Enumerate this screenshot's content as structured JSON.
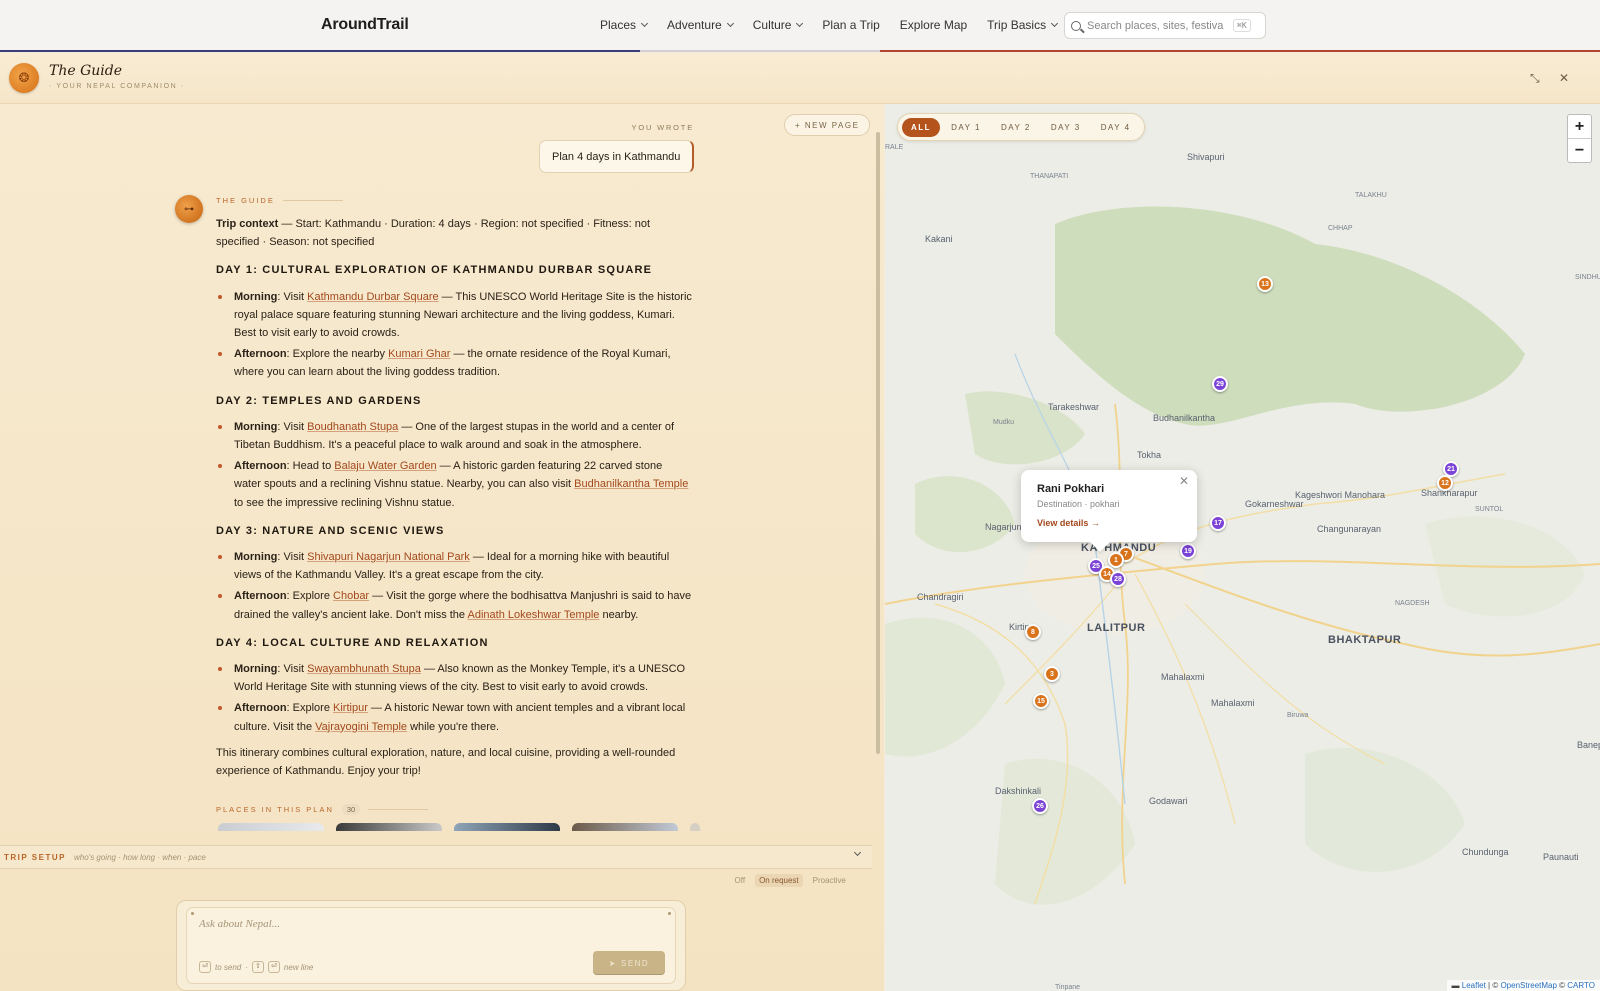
{
  "topnav": {
    "brand": "AroundTrail",
    "menu": [
      {
        "label": "Places",
        "dropdown": true
      },
      {
        "label": "Adventure",
        "dropdown": true
      },
      {
        "label": "Culture",
        "dropdown": true
      },
      {
        "label": "Plan a Trip",
        "dropdown": false
      },
      {
        "label": "Explore Map",
        "dropdown": false
      },
      {
        "label": "Trip Basics",
        "dropdown": true
      }
    ],
    "search_placeholder": "Search places, sites, festiva",
    "search_shortcut": "⌘K"
  },
  "guide": {
    "title": "The Guide",
    "subtitle": "· YOUR NEPAL COMPANION ·"
  },
  "chat": {
    "new_page": "+ NEW PAGE",
    "you_wrote": "YOU WROTE",
    "user_message": "Plan 4 days in Kathmandu",
    "guide_tag": "THE GUIDE",
    "context_label": "Trip context",
    "context_text": " — Start: Kathmandu · Duration: 4 days · Region: not specified · Fitness: not specified · Season: not specified",
    "days": [
      {
        "heading": "DAY 1: CULTURAL EXPLORATION OF KATHMANDU DURBAR SQUARE",
        "items": [
          {
            "time": "Morning",
            "pre": ": Visit ",
            "link": "Kathmandu Durbar Square",
            "post": " — This UNESCO World Heritage Site is the historic royal palace square featuring stunning Newari architecture and the living goddess, Kumari. Best to visit early to avoid crowds.",
            "link2": "",
            "post2": ""
          },
          {
            "time": "Afternoon",
            "pre": ": Explore the nearby ",
            "link": "Kumari Ghar",
            "post": " — the ornate residence of the Royal Kumari, where you can learn about the living goddess tradition.",
            "link2": "",
            "post2": ""
          }
        ]
      },
      {
        "heading": "DAY 2: TEMPLES AND GARDENS",
        "items": [
          {
            "time": "Morning",
            "pre": ": Visit ",
            "link": "Boudhanath Stupa",
            "post": " — One of the largest stupas in the world and a center of Tibetan Buddhism. It's a peaceful place to walk around and soak in the atmosphere.",
            "link2": "",
            "post2": ""
          },
          {
            "time": "Afternoon",
            "pre": ": Head to ",
            "link": "Balaju Water Garden",
            "post": " — A historic garden featuring 22 carved stone water spouts and a reclining Vishnu statue. Nearby, you can also visit ",
            "link2": "Budhanilkantha Temple",
            "post2": " to see the impressive reclining Vishnu statue."
          }
        ]
      },
      {
        "heading": "DAY 3: NATURE AND SCENIC VIEWS",
        "items": [
          {
            "time": "Morning",
            "pre": ": Visit ",
            "link": "Shivapuri Nagarjun National Park",
            "post": " — Ideal for a morning hike with beautiful views of the Kathmandu Valley. It's a great escape from the city.",
            "link2": "",
            "post2": ""
          },
          {
            "time": "Afternoon",
            "pre": ": Explore ",
            "link": "Chobar",
            "post": " — Visit the gorge where the bodhisattva Manjushri is said to have drained the valley's ancient lake. Don't miss the ",
            "link2": "Adinath Lokeshwar Temple",
            "post2": " nearby."
          }
        ]
      },
      {
        "heading": "DAY 4: LOCAL CULTURE AND RELAXATION",
        "items": [
          {
            "time": "Morning",
            "pre": ": Visit ",
            "link": "Swayambhunath Stupa",
            "post": " — Also known as the Monkey Temple, it's a UNESCO World Heritage Site with stunning views of the city. Best to visit early to avoid crowds.",
            "link2": "",
            "post2": ""
          },
          {
            "time": "Afternoon",
            "pre": ": Explore ",
            "link": "Kirtipur",
            "post": " — A historic Newar town with ancient temples and a vibrant local culture. Visit the ",
            "link2": "Vajrayogini Temple",
            "post2": " while you're there."
          }
        ]
      }
    ],
    "closing": "This itinerary combines cultural exploration, nature, and local cuisine, providing a well-rounded experience of Kathmandu. Enjoy your trip!",
    "places_tag": "PLACES IN THIS PLAN",
    "places_count": "30"
  },
  "trip_setup": {
    "title": "TRIP SETUP",
    "hint": "who's going · how long · when · pace"
  },
  "modes": {
    "off": "Off",
    "on_request": "On request",
    "proactive": "Proactive"
  },
  "composer": {
    "placeholder": "Ask about Nepal...",
    "to_send": "to send",
    "new_line": "new line",
    "send": "SEND"
  },
  "map": {
    "tabs": [
      "ALL",
      "DAY 1",
      "DAY 2",
      "DAY 3",
      "DAY 4"
    ],
    "labels": [
      "RALE",
      "Shivapuri",
      "THANAPATI",
      "TALAKHU",
      "CHHAP",
      "Kakani",
      "SINDHUKOT",
      "Tarakeshwar",
      "Budhanilkantha",
      "Mudku",
      "Tokha",
      "Gokarneshwar",
      "Kageshwori Manohara",
      "Shankharapur",
      "SUNTOL",
      "Changunarayan",
      "Nagarjun",
      "KATHMANDU",
      "Chandragiri",
      "NAGDESH",
      "Kirtipur",
      "LALITPUR",
      "BHAKTAPUR",
      "Mahalaxmi",
      "Mahalaxmi",
      "Biruwa",
      "Banep",
      "Dakshinkali",
      "Godawari",
      "Chundunga",
      "Paunauti",
      "Tinpane"
    ],
    "markers": [
      {
        "n": "13",
        "color": "orange"
      },
      {
        "n": "29",
        "color": "purple"
      },
      {
        "n": "21",
        "color": "purple"
      },
      {
        "n": "12",
        "color": "orange"
      },
      {
        "n": "17",
        "color": "purple"
      },
      {
        "n": "19",
        "color": "purple"
      },
      {
        "n": "7",
        "color": "orange"
      },
      {
        "n": "1",
        "color": "orange"
      },
      {
        "n": "25",
        "color": "purple"
      },
      {
        "n": "14",
        "color": "orange"
      },
      {
        "n": "28",
        "color": "purple"
      },
      {
        "n": "8",
        "color": "orange"
      },
      {
        "n": "3",
        "color": "orange"
      },
      {
        "n": "15",
        "color": "orange"
      },
      {
        "n": "26",
        "color": "purple"
      }
    ],
    "popup": {
      "title": "Rani Pokhari",
      "subtitle": "Destination · pokhari",
      "link": "View details →"
    },
    "zoom_in": "+",
    "zoom_out": "−",
    "attribution": {
      "leaflet": "Leaflet",
      "sep1": " | © ",
      "osm": "OpenStreetMap",
      "sep2": " © ",
      "carto": "CARTO"
    }
  }
}
